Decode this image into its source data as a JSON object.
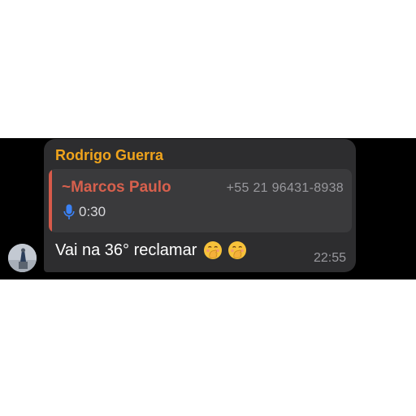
{
  "message": {
    "sender_name": "Rodrigo Guerra",
    "reply": {
      "author": "~Marcos Paulo",
      "phone": "+55 21 96431-8938",
      "audio_duration": "0:30",
      "icon": "microphone-icon"
    },
    "text": "Vai na 36° reclamar",
    "emoji": [
      "face-with-hand-over-mouth-icon",
      "face-with-hand-over-mouth-icon"
    ],
    "time": "22:55"
  },
  "colors": {
    "background_strip": "#000000",
    "bubble": "#2d2d2f",
    "quote_background": "#3a3a3c",
    "sender_name": "#f0a41c",
    "reply_author": "#d7604d",
    "quote_bar": "#d75a4a",
    "secondary_text": "#98989d",
    "mic": "#3b82f6"
  }
}
